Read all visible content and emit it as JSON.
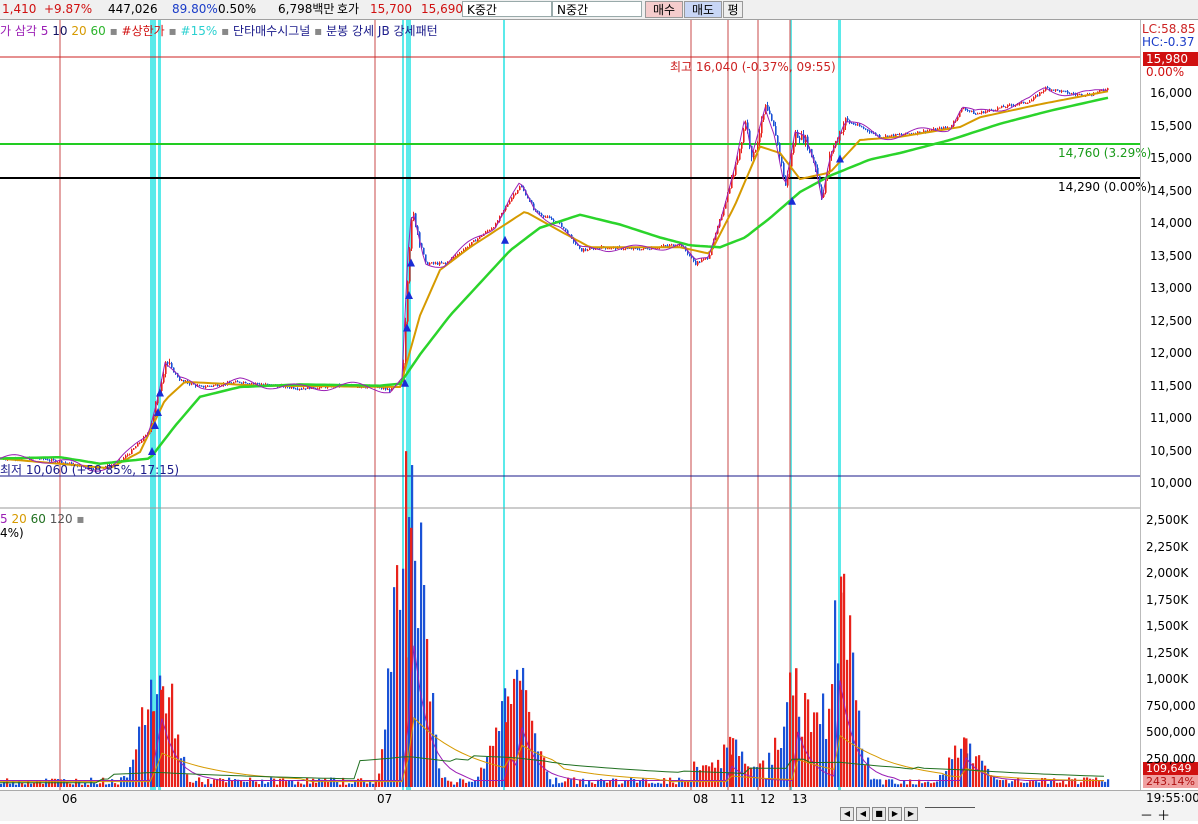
{
  "topbar": {
    "price": "1,410",
    "change": "+9.87%",
    "volume": "447,026",
    "ratio": "89.80%",
    "rate": "0.50%",
    "amount": "6,798백만",
    "hoga_label": "호가",
    "ask": "15,700",
    "bid": "15,690",
    "k_mid": "K중간",
    "n_mid": "N중간",
    "buy_button": "매수",
    "sell_button": "매도",
    "avg_button": "평"
  },
  "price_legend": {
    "name": "가 삼각",
    "ma5": "5",
    "ma10": "10",
    "ma20": "20",
    "ma60": "60",
    "upper_limit": "#상한가",
    "pct15": "#15%",
    "signal": "단타매수시그널",
    "pattern": "분봉 강세 JB 강세패턴"
  },
  "volume_legend": {
    "ma5": "5",
    "ma20": "20",
    "ma60": "60",
    "ma120": "120",
    "partial": "4%)"
  },
  "annotations": {
    "high": "최고 16,040 (-0.37%, 09:55)",
    "low": "최저 10,060 (+58.85%, 17:15)",
    "line_green": "14,760 (3.29%)",
    "line_black": "14,290 (0.00%)"
  },
  "right_top": {
    "lc": "LC:58.85",
    "hc": "HC:-0.37",
    "current": "15,980",
    "current_pct": "0.00%",
    "vol_current": "109,649",
    "vol_pct": "243.14%"
  },
  "price_axis": [
    "16,000",
    "15,500",
    "15,000",
    "14,500",
    "14,000",
    "13,500",
    "13,000",
    "12,500",
    "12,000",
    "11,500",
    "11,000",
    "10,500",
    "10,000"
  ],
  "volume_axis": [
    "2,500K",
    "2,250K",
    "2,000K",
    "1,750K",
    "1,500K",
    "1,250K",
    "1,000K",
    "750,000",
    "500,000",
    "250,000"
  ],
  "dates": [
    "06",
    "07",
    "08",
    "11",
    "12",
    "13"
  ],
  "time_label": "19:55:00",
  "colors": {
    "up": "#e8221b",
    "down": "#1a52d6",
    "ma5": "#9b1fb5",
    "ma10": "#101060",
    "ma20": "#d69a00",
    "ma60": "#2bd42b",
    "signal": "#3ee6e6",
    "separator": "#c84a4a"
  },
  "chart_data": {
    "type": "candlestick",
    "price_path": [
      [
        0,
        10300
      ],
      [
        40,
        10300
      ],
      [
        60,
        10250
      ],
      [
        90,
        10150
      ],
      [
        115,
        10200
      ],
      [
        130,
        10400
      ],
      [
        148,
        10700
      ],
      [
        158,
        11300
      ],
      [
        165,
        11800
      ],
      [
        180,
        11500
      ],
      [
        200,
        11400
      ],
      [
        240,
        11480
      ],
      [
        300,
        11380
      ],
      [
        340,
        11420
      ],
      [
        375,
        11400
      ],
      [
        390,
        11350
      ],
      [
        402,
        11500
      ],
      [
        408,
        13400
      ],
      [
        412,
        14100
      ],
      [
        425,
        13300
      ],
      [
        445,
        13300
      ],
      [
        470,
        13600
      ],
      [
        495,
        13900
      ],
      [
        510,
        14300
      ],
      [
        520,
        14500
      ],
      [
        535,
        14100
      ],
      [
        560,
        13900
      ],
      [
        580,
        13500
      ],
      [
        600,
        13550
      ],
      [
        640,
        13520
      ],
      [
        680,
        13600
      ],
      [
        695,
        13300
      ],
      [
        708,
        13400
      ],
      [
        720,
        14000
      ],
      [
        735,
        14800
      ],
      [
        745,
        15500
      ],
      [
        752,
        14900
      ],
      [
        765,
        15700
      ],
      [
        775,
        15300
      ],
      [
        785,
        14500
      ],
      [
        795,
        15300
      ],
      [
        805,
        15200
      ],
      [
        815,
        14800
      ],
      [
        822,
        14300
      ],
      [
        830,
        15000
      ],
      [
        845,
        15500
      ],
      [
        860,
        15400
      ],
      [
        880,
        15250
      ],
      [
        910,
        15300
      ],
      [
        950,
        15400
      ],
      [
        962,
        15700
      ],
      [
        975,
        15600
      ],
      [
        1000,
        15700
      ],
      [
        1030,
        15800
      ],
      [
        1045,
        16000
      ],
      [
        1075,
        15900
      ],
      [
        1090,
        15900
      ],
      [
        1108,
        16000
      ]
    ],
    "ma60_path": [
      [
        0,
        10300
      ],
      [
        60,
        10320
      ],
      [
        100,
        10220
      ],
      [
        150,
        10300
      ],
      [
        175,
        10800
      ],
      [
        200,
        11250
      ],
      [
        240,
        11400
      ],
      [
        300,
        11440
      ],
      [
        380,
        11420
      ],
      [
        400,
        11450
      ],
      [
        420,
        11900
      ],
      [
        450,
        12500
      ],
      [
        480,
        13000
      ],
      [
        510,
        13500
      ],
      [
        540,
        13850
      ],
      [
        580,
        14050
      ],
      [
        620,
        13900
      ],
      [
        660,
        13700
      ],
      [
        690,
        13580
      ],
      [
        720,
        13550
      ],
      [
        745,
        13700
      ],
      [
        770,
        14000
      ],
      [
        800,
        14400
      ],
      [
        830,
        14650
      ],
      [
        870,
        14900
      ],
      [
        900,
        15000
      ],
      [
        950,
        15200
      ],
      [
        1000,
        15450
      ],
      [
        1050,
        15650
      ],
      [
        1108,
        15850
      ]
    ],
    "ma20_path": [
      [
        0,
        10300
      ],
      [
        110,
        10150
      ],
      [
        140,
        10400
      ],
      [
        165,
        11200
      ],
      [
        185,
        11480
      ],
      [
        260,
        11420
      ],
      [
        400,
        11400
      ],
      [
        420,
        12500
      ],
      [
        440,
        13200
      ],
      [
        470,
        13550
      ],
      [
        500,
        13850
      ],
      [
        525,
        14100
      ],
      [
        560,
        13800
      ],
      [
        590,
        13550
      ],
      [
        680,
        13550
      ],
      [
        710,
        13450
      ],
      [
        735,
        14200
      ],
      [
        760,
        15100
      ],
      [
        780,
        15000
      ],
      [
        800,
        14600
      ],
      [
        830,
        14700
      ],
      [
        860,
        15200
      ],
      [
        900,
        15250
      ],
      [
        960,
        15400
      ],
      [
        980,
        15550
      ],
      [
        1040,
        15750
      ],
      [
        1108,
        15950
      ]
    ],
    "volume_bursts": [
      [
        152,
        700
      ],
      [
        160,
        900
      ],
      [
        405,
        1200
      ],
      [
        410,
        2400
      ],
      [
        505,
        600
      ],
      [
        520,
        900
      ],
      [
        730,
        300
      ],
      [
        795,
        1100
      ],
      [
        840,
        1800
      ],
      [
        965,
        450
      ]
    ],
    "vertical_separators": [
      60,
      375,
      691,
      728,
      758,
      790
    ],
    "signal_bands": [
      [
        150,
        156
      ],
      [
        158,
        161
      ],
      [
        402,
        404
      ],
      [
        406,
        411
      ],
      [
        503,
        505
      ],
      [
        790,
        792
      ],
      [
        838,
        841
      ]
    ],
    "signal_points": [
      [
        152,
        10400
      ],
      [
        155,
        10800
      ],
      [
        158,
        11000
      ],
      [
        160,
        11300
      ],
      [
        405,
        11450
      ],
      [
        407,
        12300
      ],
      [
        409,
        12800
      ],
      [
        411,
        13300
      ],
      [
        505,
        13650
      ],
      [
        792,
        14250
      ],
      [
        840,
        14900
      ]
    ],
    "ylim": [
      9850,
      16200
    ],
    "vol_ylim": [
      0,
      2600
    ]
  }
}
